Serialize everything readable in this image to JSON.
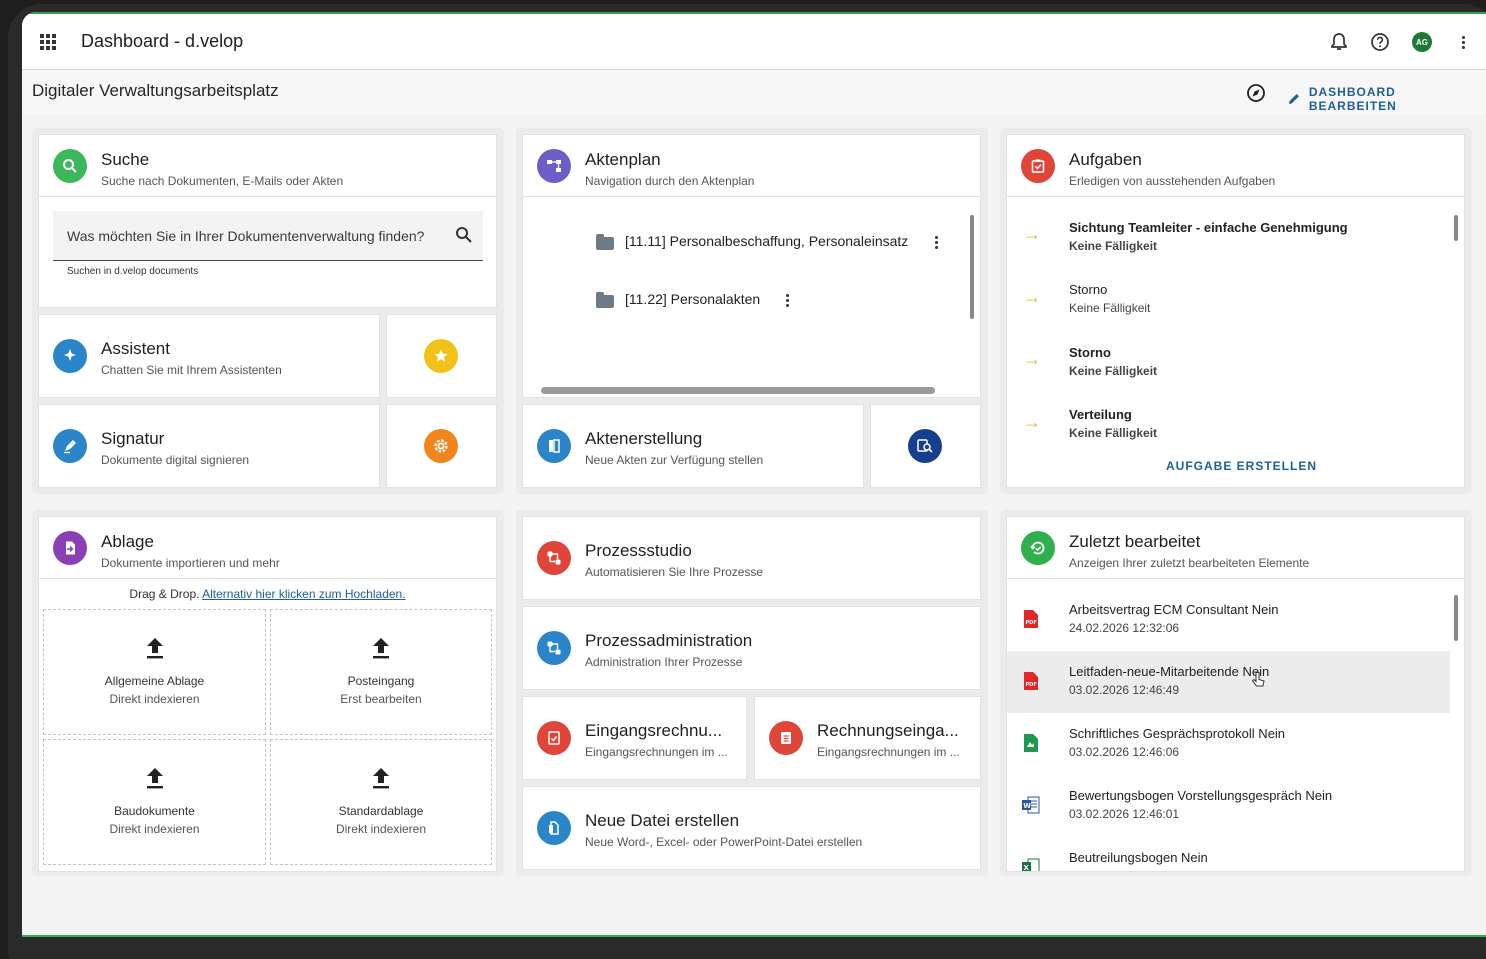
{
  "appbar": {
    "title": "Dashboard - d.velop",
    "avatar_initials": "AG"
  },
  "subbar": {
    "title": "Digitaler Verwaltungsarbeitsplatz",
    "edit_label": "DASHBOARD BEARBEITEN"
  },
  "suche": {
    "title": "Suche",
    "subtitle": "Suche nach Dokumenten, E-Mails oder Akten",
    "placeholder": "Was möchten Sie in Ihrer Dokumentenverwaltung finden?",
    "help": "Suchen in d.velop documents",
    "color": "#3bb85a"
  },
  "assistent": {
    "title": "Assistent",
    "subtitle": "Chatten Sie mit Ihrem Assistenten",
    "color": "#2a86c9"
  },
  "signatur": {
    "title": "Signatur",
    "subtitle": "Dokumente digital signieren",
    "color": "#2a86c9"
  },
  "aktenplan": {
    "title": "Aktenplan",
    "subtitle": "Navigation durch den Aktenplan",
    "items": [
      "[11.11] Personalbeschaffung, Personaleinsatz",
      "[11.22] Personalakten"
    ],
    "color": "#6b5fc7"
  },
  "aktenerstellung": {
    "title": "Aktenerstellung",
    "subtitle": "Neue Akten zur Verfügung stellen",
    "color": "#2a86c9"
  },
  "aufgaben": {
    "title": "Aufgaben",
    "subtitle": "Erledigen von ausstehenden Aufgaben",
    "tasks": [
      {
        "title": "Sichtung Teamleiter - einfache Genehmigung",
        "due": "Keine Fälligkeit",
        "bold": true
      },
      {
        "title": "Storno",
        "due": "Keine Fälligkeit",
        "bold": false
      },
      {
        "title": "Storno",
        "due": "Keine Fälligkeit",
        "bold": true
      },
      {
        "title": "Verteilung",
        "due": "Keine Fälligkeit",
        "bold": true
      }
    ],
    "create_label": "AUFGABE ERSTELLEN",
    "color": "#e0453a"
  },
  "ablage": {
    "title": "Ablage",
    "subtitle": "Dokumente importieren und mehr",
    "drag_text": "Drag & Drop.",
    "upload_link": "Alternativ hier klicken zum Hochladen.",
    "targets": [
      {
        "name": "Allgemeine Ablage",
        "action": "Direkt indexieren"
      },
      {
        "name": "Posteingang",
        "action": "Erst bearbeiten"
      },
      {
        "name": "Baudokumente",
        "action": "Direkt indexieren"
      },
      {
        "name": "Standardablage",
        "action": "Direkt indexieren"
      }
    ],
    "color": "#8b3fb5"
  },
  "prozessstudio": {
    "title": "Prozessstudio",
    "subtitle": "Automatisieren Sie Ihre Prozesse",
    "color": "#e0453a"
  },
  "prozessadmin": {
    "title": "Prozessadministration",
    "subtitle": "Administration Ihrer Prozesse",
    "color": "#2a86c9"
  },
  "eingangsrechnung": {
    "title": "Eingangsrechnu...",
    "subtitle": "Eingangsrechnungen im ...",
    "color": "#e0453a"
  },
  "rechnungseingang": {
    "title": "Rechnungseinga...",
    "subtitle": "Eingangsrechnungen im ...",
    "color": "#e0453a"
  },
  "neue_datei": {
    "title": "Neue Datei erstellen",
    "subtitle": "Neue Word-, Excel- oder PowerPoint-Datei erstellen",
    "color": "#2a86c9"
  },
  "zuletzt": {
    "title": "Zuletzt bearbeitet",
    "subtitle": "Anzeigen Ihrer zuletzt bearbeiteten Elemente",
    "docs": [
      {
        "name": "Arbeitsvertrag ECM Consultant Nein",
        "date": "24.02.2026 12:32:06",
        "type": "pdf"
      },
      {
        "name": "Leitfaden-neue-Mitarbeitende Nein",
        "date": "03.02.2026 12:46:49",
        "type": "pdf"
      },
      {
        "name": "Schriftliches Gesprächsprotokoll Nein",
        "date": "03.02.2026 12:46:06",
        "type": "sheet"
      },
      {
        "name": "Bewertungsbogen Vorstellungsgespräch Nein",
        "date": "03.02.2026 12:46:01",
        "type": "word"
      },
      {
        "name": "Beutreilungsbogen Nein",
        "date": "",
        "type": "excel"
      }
    ],
    "color": "#2fb04d"
  }
}
